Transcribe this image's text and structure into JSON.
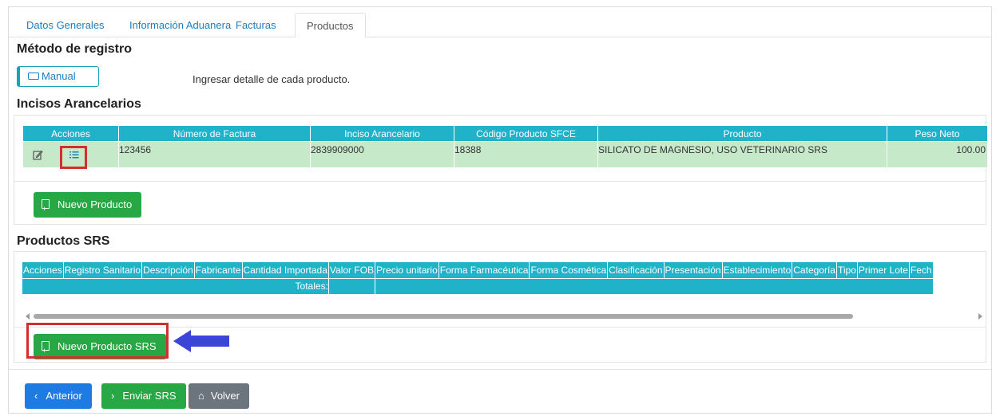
{
  "tabs": [
    "Datos Generales",
    "Información Aduanera",
    "Facturas",
    "Productos"
  ],
  "metodo": {
    "title": "Método de registro",
    "manual_label": "Manual",
    "hint": "Ingresar detalle de cada producto."
  },
  "incisos": {
    "title": "Incisos Arancelarios",
    "headers": [
      "Acciones",
      "Número de Factura",
      "Inciso Arancelario",
      "Código Producto SFCE",
      "Producto",
      "Peso Neto"
    ],
    "row": {
      "factura": "123456",
      "inciso": "2839909000",
      "codigo": "18388",
      "producto": "SILICATO DE MAGNESIO, USO VETERINARIO SRS",
      "peso": "100.00"
    },
    "new_button": "Nuevo Producto"
  },
  "productos_srs": {
    "title": "Productos SRS",
    "headers": [
      "Acciones",
      "Registro Sanitario",
      "Descripción",
      "Fabricante",
      "Cantidad Importada",
      "Valor FOB",
      "Precio unitario",
      "Forma Farmacéutica",
      "Forma Cosmética",
      "Clasificación",
      "Presentación",
      "Establecimiento",
      "Categoría",
      "Tipo",
      "Primer Lote",
      "Fech"
    ],
    "totales_label": "Totales:",
    "new_button": "Nuevo Producto SRS"
  },
  "footer": {
    "anterior": "Anterior",
    "enviar": "Enviar SRS",
    "volver": "Volver"
  },
  "colors": {
    "header_teal": "#20b2c8",
    "row_green": "#c6e9c9",
    "button_green": "#28a745",
    "button_blue": "#1e7be3",
    "button_gray": "#6c757d",
    "highlight_red": "#d32f2f",
    "arrow_blue": "#3b46d6"
  }
}
